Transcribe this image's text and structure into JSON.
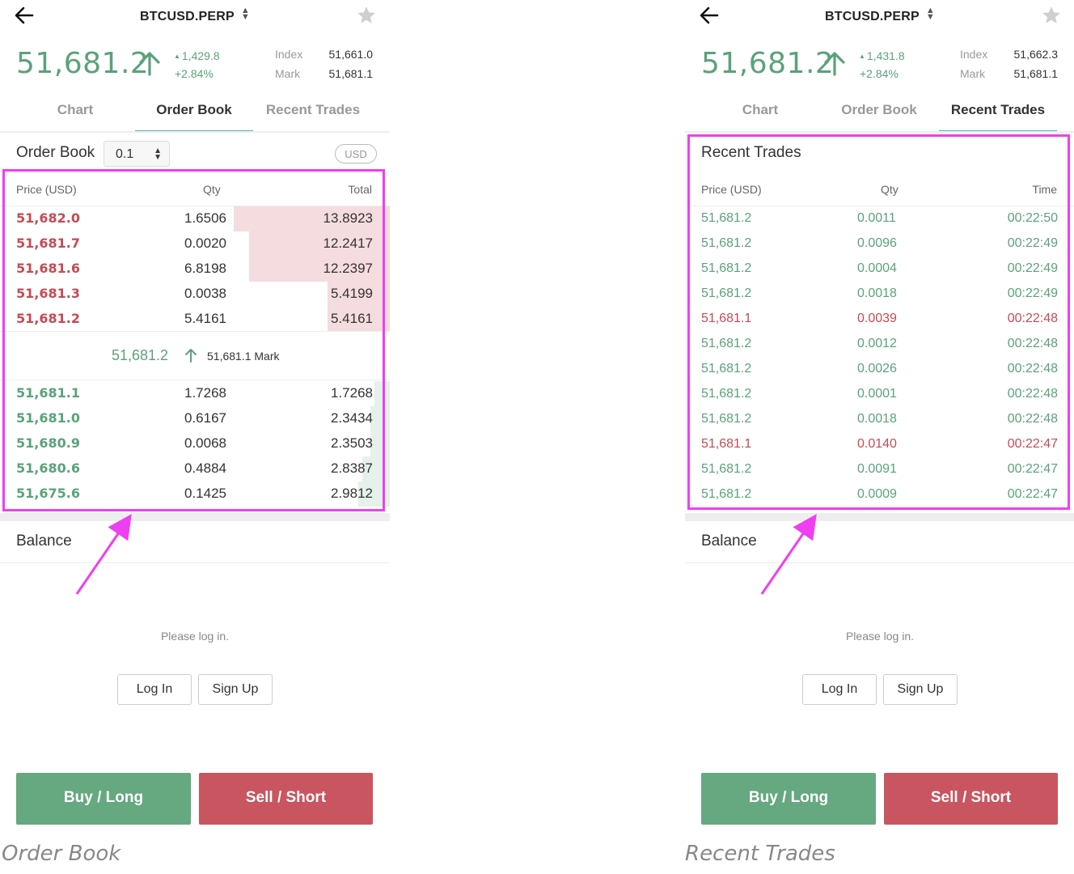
{
  "colors": {
    "green": "#5ba27a",
    "red": "#c54b54",
    "accent_tab": "#5fb3a6",
    "highlight": "#ee3ff0"
  },
  "left": {
    "symbol": "BTCUSD.PERP",
    "last_price": "51,681.2",
    "change_abs": "1,429.8",
    "change_pct": "+2.84%",
    "index_label": "Index",
    "index_value": "51,661.0",
    "mark_label": "Mark",
    "mark_value": "51,681.1",
    "tabs": [
      "Chart",
      "Order Book",
      "Recent Trades"
    ],
    "active_tab": "Order Book",
    "section_title": "Order Book",
    "precision": "0.1",
    "currency_toggle": "USD",
    "columns": [
      "Price (USD)",
      "Qty",
      "Total"
    ],
    "asks": [
      {
        "price": "51,682.0",
        "qty": "1.6506",
        "total": "13.8923",
        "depth_fraction": 0.4
      },
      {
        "price": "51,681.7",
        "qty": "0.0020",
        "total": "12.2417",
        "depth_fraction": 0.36
      },
      {
        "price": "51,681.6",
        "qty": "6.8198",
        "total": "12.2397",
        "depth_fraction": 0.36
      },
      {
        "price": "51,681.3",
        "qty": "0.0038",
        "total": "5.4199",
        "depth_fraction": 0.16
      },
      {
        "price": "51,681.2",
        "qty": "5.4161",
        "total": "5.4161",
        "depth_fraction": 0.16
      }
    ],
    "mid_price": "51,681.2",
    "mid_mark": "51,681.1 Mark",
    "bids": [
      {
        "price": "51,681.1",
        "qty": "1.7268",
        "total": "1.7268",
        "depth_fraction": 0.04
      },
      {
        "price": "51,681.0",
        "qty": "0.6167",
        "total": "2.3434",
        "depth_fraction": 0.05
      },
      {
        "price": "51,680.9",
        "qty": "0.0068",
        "total": "2.3503",
        "depth_fraction": 0.05
      },
      {
        "price": "51,680.6",
        "qty": "0.4884",
        "total": "2.8387",
        "depth_fraction": 0.07
      },
      {
        "price": "51,675.6",
        "qty": "0.1425",
        "total": "2.9812",
        "depth_fraction": 0.08
      }
    ],
    "balance_title": "Balance",
    "login_msg": "Please log in.",
    "login_btn": "Log In",
    "signup_btn": "Sign Up",
    "buy_btn": "Buy / Long",
    "sell_btn": "Sell / Short",
    "caption": "Order Book"
  },
  "right": {
    "symbol": "BTCUSD.PERP",
    "last_price": "51,681.2",
    "change_abs": "1,431.8",
    "change_pct": "+2.84%",
    "index_label": "Index",
    "index_value": "51,662.3",
    "mark_label": "Mark",
    "mark_value": "51,681.1",
    "tabs": [
      "Chart",
      "Order Book",
      "Recent Trades"
    ],
    "active_tab": "Recent Trades",
    "section_title": "Recent Trades",
    "columns": [
      "Price (USD)",
      "Qty",
      "Time"
    ],
    "trades": [
      {
        "price": "51,681.2",
        "qty": "0.0011",
        "time": "00:22:50",
        "side": "buy"
      },
      {
        "price": "51,681.2",
        "qty": "0.0096",
        "time": "00:22:49",
        "side": "buy"
      },
      {
        "price": "51,681.2",
        "qty": "0.0004",
        "time": "00:22:49",
        "side": "buy"
      },
      {
        "price": "51,681.2",
        "qty": "0.0018",
        "time": "00:22:49",
        "side": "buy"
      },
      {
        "price": "51,681.1",
        "qty": "0.0039",
        "time": "00:22:48",
        "side": "sell"
      },
      {
        "price": "51,681.2",
        "qty": "0.0012",
        "time": "00:22:48",
        "side": "buy"
      },
      {
        "price": "51,681.2",
        "qty": "0.0026",
        "time": "00:22:48",
        "side": "buy"
      },
      {
        "price": "51,681.2",
        "qty": "0.0001",
        "time": "00:22:48",
        "side": "buy"
      },
      {
        "price": "51,681.2",
        "qty": "0.0018",
        "time": "00:22:48",
        "side": "buy"
      },
      {
        "price": "51,681.1",
        "qty": "0.0140",
        "time": "00:22:47",
        "side": "sell"
      },
      {
        "price": "51,681.2",
        "qty": "0.0091",
        "time": "00:22:47",
        "side": "buy"
      },
      {
        "price": "51,681.2",
        "qty": "0.0009",
        "time": "00:22:47",
        "side": "buy"
      }
    ],
    "balance_title": "Balance",
    "login_msg": "Please log in.",
    "login_btn": "Log In",
    "signup_btn": "Sign Up",
    "buy_btn": "Buy / Long",
    "sell_btn": "Sell / Short",
    "caption": "Recent Trades"
  }
}
